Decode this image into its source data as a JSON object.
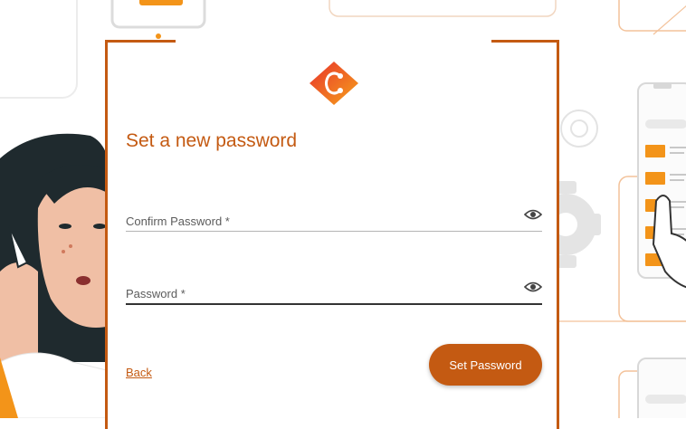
{
  "form": {
    "title": "Set a new password",
    "fields": [
      {
        "placeholder": "Confirm Password *",
        "value": ""
      },
      {
        "placeholder": "Password *",
        "value": ""
      }
    ],
    "back_label": "Back",
    "submit_label": "Set Password"
  },
  "theme": {
    "accent": "#c45a12",
    "logo_gradient": [
      "#e8322c",
      "#f6a21b"
    ]
  },
  "icons": {
    "logo": "brand-logo-icon",
    "visibility_toggle": "eye-icon"
  }
}
